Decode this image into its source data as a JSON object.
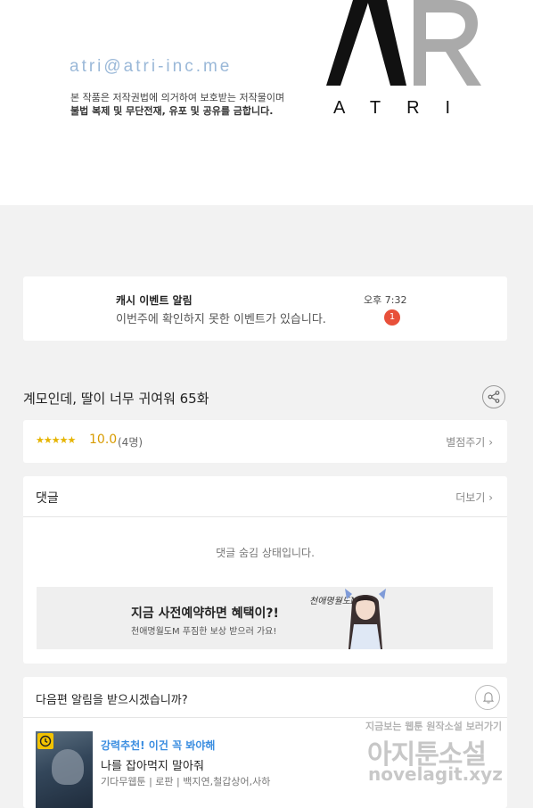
{
  "header": {
    "email": "atri@atri-inc.me",
    "copyright_line1": "본 작품은 저작권법에 의거하여 보호받는 저작물이며",
    "copyright_line2": "불법 복제 및 무단전재, 유포 및 공유를 금합니다.",
    "brand": "ATRI"
  },
  "notification": {
    "title": "캐시 이벤트 알림",
    "message": "이번주에 확인하지 못한 이벤트가 있습니다.",
    "time": "오후 7:32",
    "badge": "1"
  },
  "episode": {
    "title": "계모인데, 딸이 너무 귀여워 65화",
    "share_icon": "share-icon"
  },
  "rating": {
    "stars": "★★★★★",
    "score": "10.0",
    "count": "(4명)",
    "rate_button": "별점주기"
  },
  "comments": {
    "title": "댓글",
    "more": "더보기",
    "hidden_message": "댓글 숨김 상태입니다.",
    "banner": {
      "title": "지금 사전예약하면 혜택이?!",
      "subtitle": "천애명월도M 푸짐한 보상 받으러 가요!",
      "logo_text": "천애명월도M"
    }
  },
  "next_episode": {
    "prompt": "다음편 알림을 받으시겠습니까?",
    "bell_icon": "bell-icon",
    "recommendation": {
      "tag": "강력추천! 이건 꼭 봐야해",
      "title": "나를 잡아먹지 말아줘",
      "meta": "기다무웹툰 | 로판 | 백지연,철갑상어,사하"
    }
  },
  "watermark": {
    "line1": "지금보는 웹툰 원작소설 보러가기",
    "line2": "아지툰소설",
    "line3": "novelagit.xyz"
  },
  "colors": {
    "accent_blue": "#3a8de0",
    "star": "#e6b400",
    "badge_red": "#e8503a",
    "email_blue": "#9ab8d8"
  }
}
